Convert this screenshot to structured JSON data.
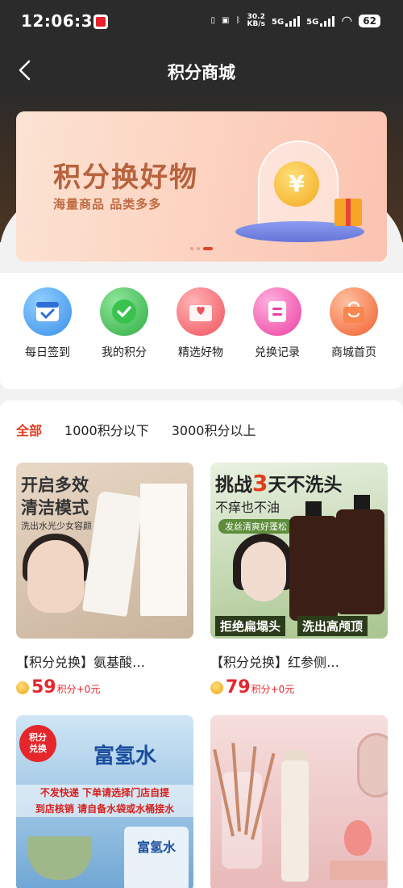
{
  "status_bar": {
    "time": "12:06:30",
    "net_speed_value": "30.2",
    "net_speed_unit": "KB/s",
    "signal1": "5G",
    "signal2": "5G",
    "battery": "62"
  },
  "nav": {
    "title": "积分商城",
    "back_icon": "chevron-left-icon"
  },
  "banner": {
    "title": "积分换好物",
    "subtitle": "海量商品 品类多多",
    "coin_symbol": "¥",
    "dots": 3,
    "active_dot": 2
  },
  "quick_menu": [
    {
      "label": "每日签到",
      "icon": "calendar-check-icon",
      "color": "#4aa3ee"
    },
    {
      "label": "我的积分",
      "icon": "badge-check-icon",
      "color": "#3dbb4f"
    },
    {
      "label": "精选好物",
      "icon": "heart-envelope-icon",
      "color": "#f05b64"
    },
    {
      "label": "兑换记录",
      "icon": "record-list-icon",
      "color": "#f04aa6"
    },
    {
      "label": "商城首页",
      "icon": "shopping-bag-icon",
      "color": "#f56d3a"
    }
  ],
  "tabs": [
    {
      "label": "全部",
      "active": true
    },
    {
      "label": "1000积分以下",
      "active": false
    },
    {
      "label": "3000积分以上",
      "active": false
    }
  ],
  "products": [
    {
      "name": "【积分兑换】氨基酸…",
      "points": "59",
      "points_unit": "积分+0元",
      "image": {
        "line1": "开启多效",
        "line2": "清洁模式",
        "line3": "洗出水光少女容颜"
      }
    },
    {
      "name": "【积分兑换】红参侧…",
      "points": "79",
      "points_unit": "积分+0元",
      "image": {
        "line1_a": "挑战",
        "line1_b": "3",
        "line1_c": "天不洗头",
        "line2": "不痒也不油",
        "tag": "发丝清爽好蓬松",
        "bar1": "拒绝扁塌头",
        "bar2": "洗出高颅顶"
      }
    },
    {
      "name": "",
      "image": {
        "badge_l1": "积分",
        "badge_l2": "兑换",
        "brand": "富氢水",
        "notice1": "不发快递 下单请选择门店自提",
        "notice2": "到店核销 请自备水袋或水桶接水",
        "bag_text": "富氢水"
      }
    },
    {
      "name": "",
      "image": {}
    }
  ],
  "colors": {
    "accent": "#e23d1f",
    "price": "#e5262b",
    "header_bg": "#2b2b2b"
  }
}
